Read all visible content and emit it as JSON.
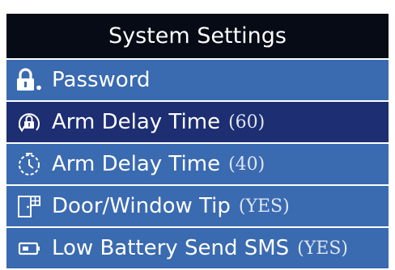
{
  "header": {
    "title": "System Settings"
  },
  "menu": {
    "items": [
      {
        "icon": "lock-icon",
        "label": "Password",
        "value": ""
      },
      {
        "icon": "arm-delay-lock-icon",
        "label": "Arm Delay Time",
        "value": "(60)",
        "selected": true
      },
      {
        "icon": "arm-delay-timer-icon",
        "label": "Arm Delay Time",
        "value": "(40)"
      },
      {
        "icon": "door-window-icon",
        "label": "Door/Window Tip",
        "value": "(YES)"
      },
      {
        "icon": "battery-icon",
        "label": "Low Battery Send SMS",
        "value": "(YES)"
      }
    ]
  },
  "colors": {
    "title_bar": "#060b16",
    "item_background": "#3a6ab0",
    "selected_background": "#1d2e72",
    "text": "#ffffff"
  }
}
